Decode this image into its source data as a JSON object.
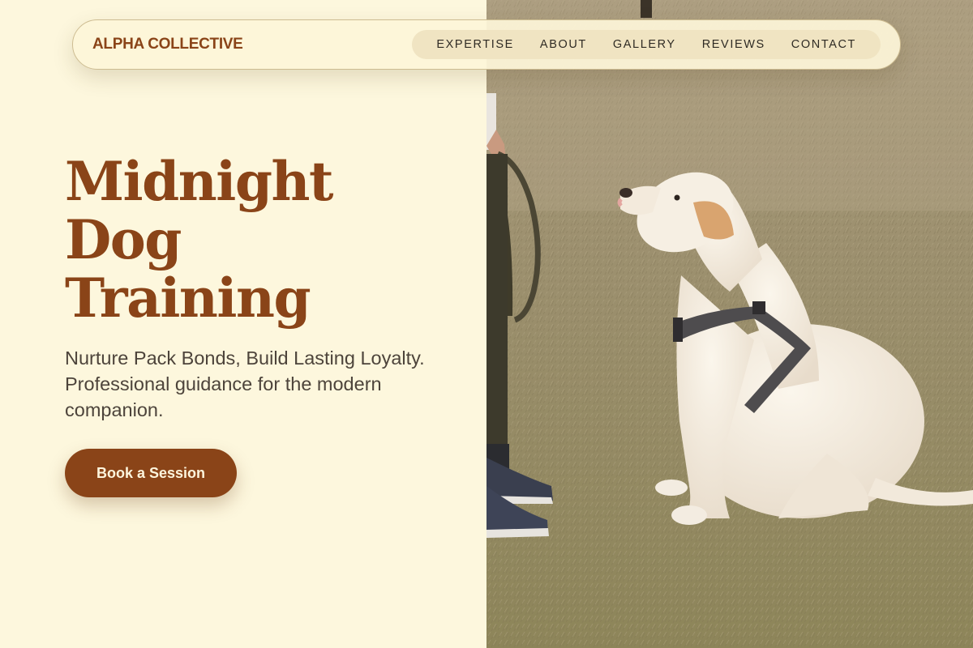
{
  "brand": {
    "name": "ALPHA COLLECTIVE"
  },
  "nav": {
    "items": [
      {
        "label": "EXPERTISE"
      },
      {
        "label": "ABOUT"
      },
      {
        "label": "GALLERY"
      },
      {
        "label": "REVIEWS"
      },
      {
        "label": "CONTACT"
      }
    ]
  },
  "hero": {
    "title_lines": [
      "Midnight",
      "Dog",
      "Training"
    ],
    "subtitle": "Nurture Pack Bonds, Build Lasting Loyalty. Professional guidance for the modern companion.",
    "cta_label": "Book a Session"
  },
  "photo": {
    "subject": "labrador-with-harness-on-grass"
  },
  "colors": {
    "background": "#fdf7dd",
    "accent": "#8a4418",
    "nav_pill": "#f0e4c2",
    "body_text": "#4d443b"
  }
}
